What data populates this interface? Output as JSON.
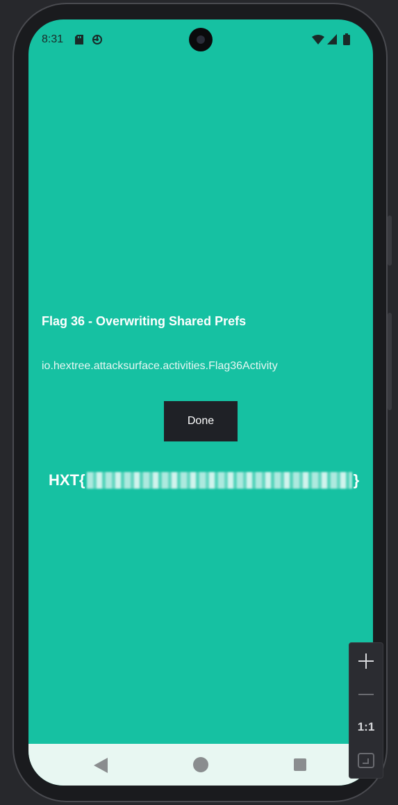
{
  "status_bar": {
    "time": "8:31",
    "icons": [
      "sd-card-icon",
      "pinwheel-icon",
      "wifi-icon",
      "cellular-signal-icon",
      "battery-icon"
    ]
  },
  "app": {
    "title": "Flag 36 - Overwriting Shared Prefs",
    "activity_name": "io.hextree.attacksurface.activities.Flag36Activity",
    "done_label": "Done",
    "flag_prefix": "HXT{",
    "flag_suffix": "}",
    "background_color": "#16c1a2",
    "button_color": "#1f2126"
  },
  "nav_bar": {
    "buttons": [
      "back-icon",
      "home-icon",
      "recents-icon"
    ]
  },
  "zoom_controls": {
    "reset_label": "1:1",
    "buttons": [
      "zoom-in-icon",
      "zoom-out-icon",
      "zoom-reset",
      "fit-screen-icon"
    ]
  }
}
